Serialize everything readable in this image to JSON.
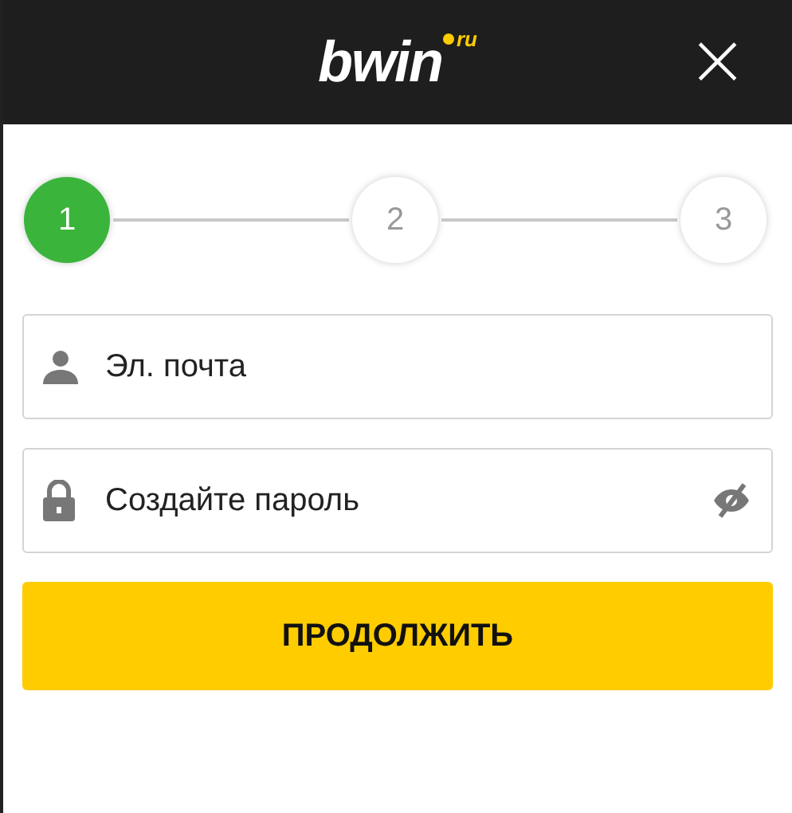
{
  "header": {
    "logo": "bwin",
    "logo_suffix": "ru",
    "close": "×"
  },
  "steps": [
    {
      "label": "1",
      "selected": true
    },
    {
      "label": "2",
      "selected": false
    },
    {
      "label": "3",
      "selected": false
    }
  ],
  "fields": [
    {
      "kind": "email",
      "placeholder": "Эл. почта"
    },
    {
      "kind": "password",
      "placeholder": "Создайте пароль"
    }
  ],
  "button": "ПРОДОЛЖИТЬ"
}
